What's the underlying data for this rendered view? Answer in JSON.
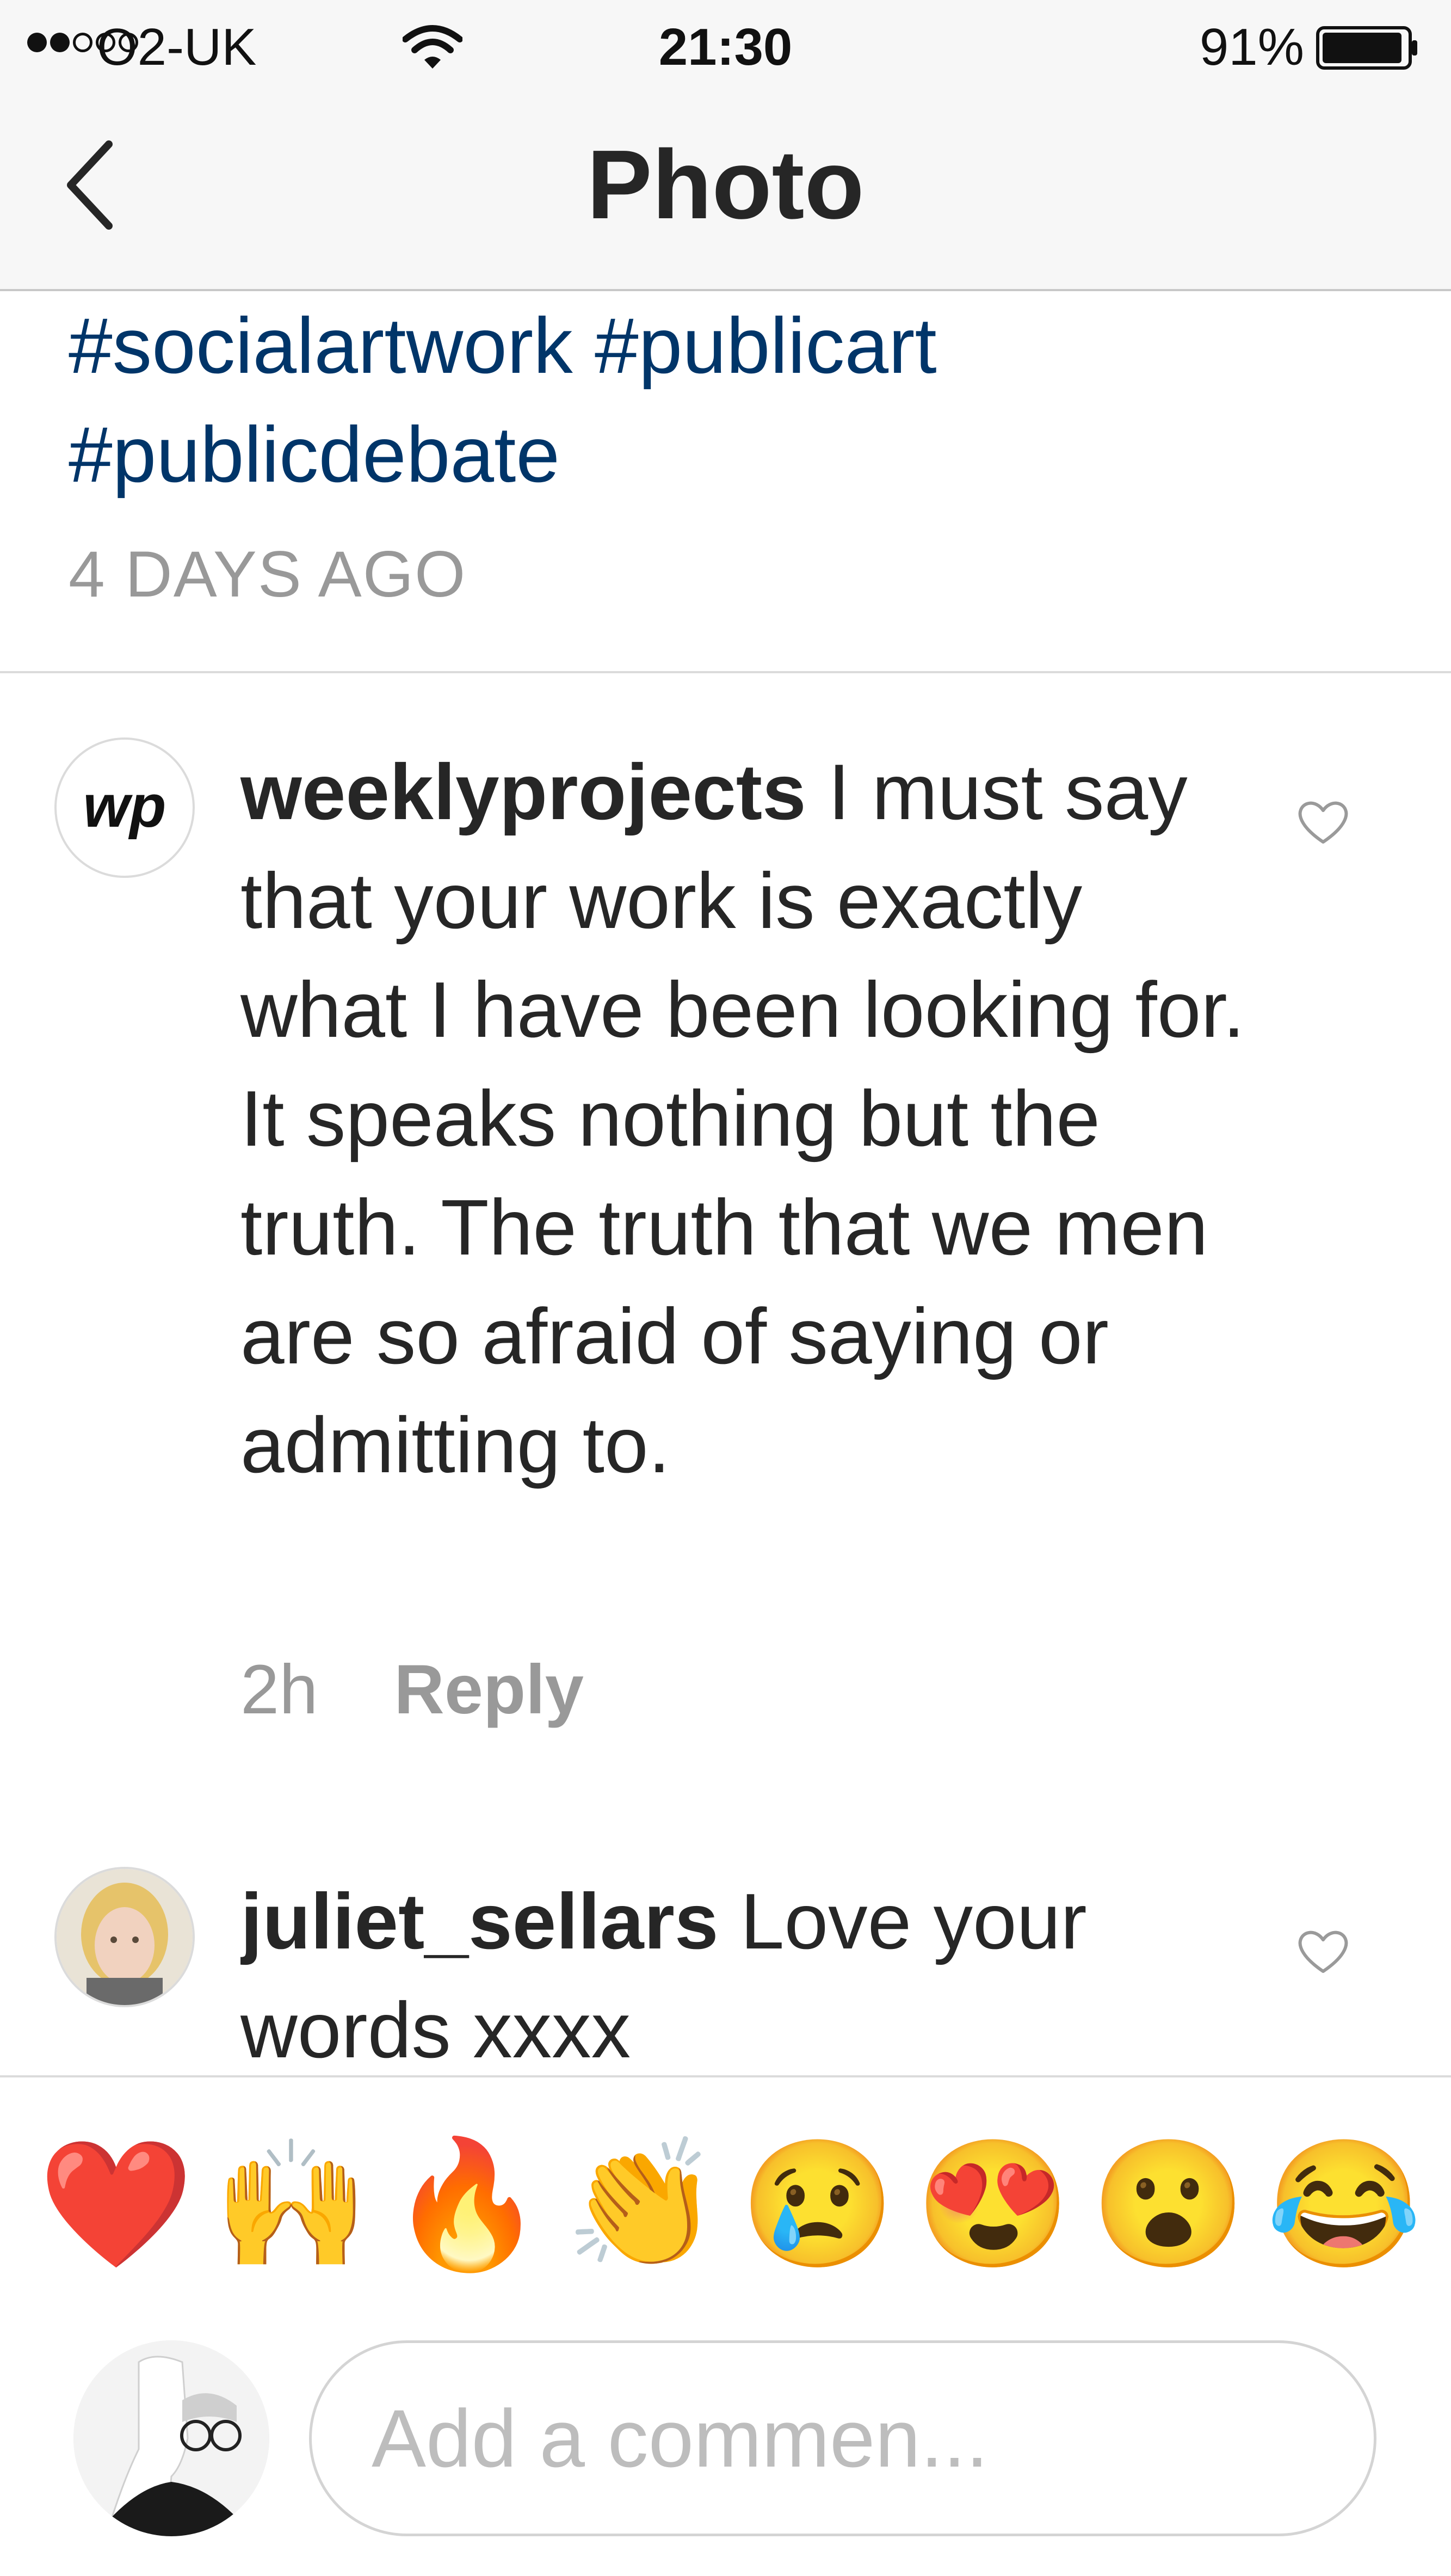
{
  "status_bar": {
    "carrier": "O2-UK",
    "time": "21:30",
    "battery": "91%",
    "signal_filled": 2,
    "signal_empty": 3
  },
  "nav": {
    "title": "Photo",
    "back_icon": "chevron-left-icon"
  },
  "caption": {
    "hashtags": "#socialartwork #publicart #publicdebate",
    "time_ago": "4 DAYS AGO"
  },
  "comments": [
    {
      "username": "weeklyprojects",
      "text": " I must say that your work is exactly what I have been looking for. It speaks nothing but the truth. The truth that we men are so afraid of saying or admitting to.",
      "avatar_logo": "wp",
      "time": "2h",
      "reply_label": "Reply"
    },
    {
      "username": "juliet_sellars",
      "text": " Love your words xxxx"
    }
  ],
  "emoji_bar": [
    "❤️",
    "🙌",
    "🔥",
    "👏",
    "😢",
    "😍",
    "😮",
    "😂"
  ],
  "composer": {
    "placeholder": "Add a commen..."
  },
  "colors": {
    "hashtag": "#003569",
    "muted": "#999999",
    "text": "#262626"
  }
}
